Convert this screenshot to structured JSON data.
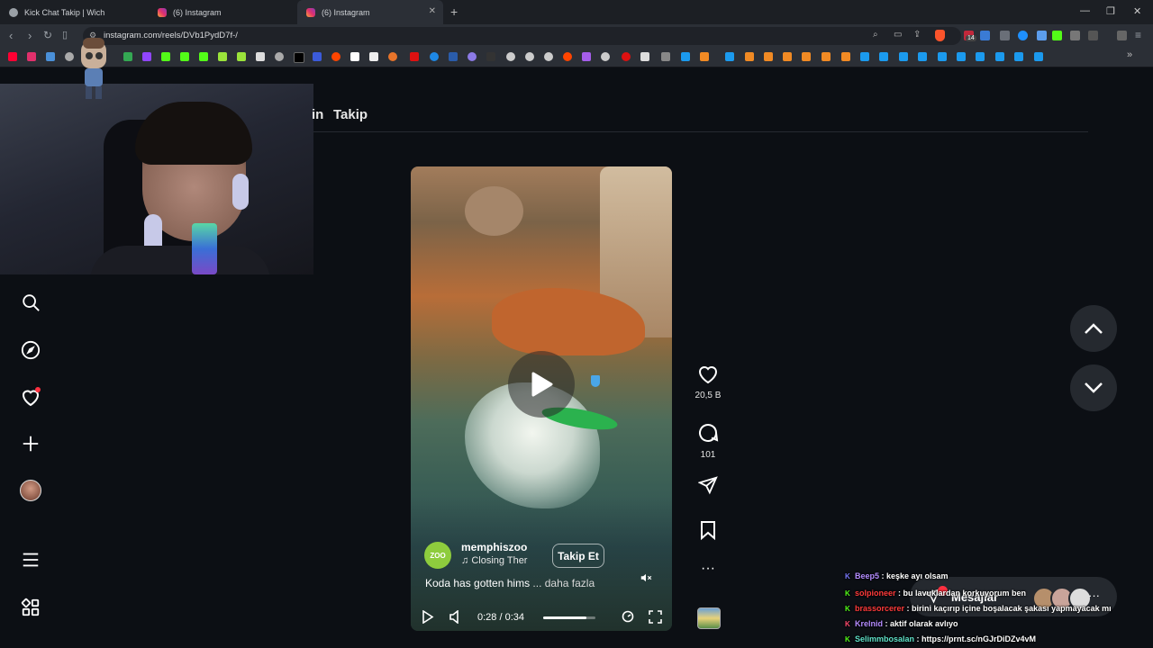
{
  "browser": {
    "tabs": [
      {
        "label": "Kick Chat Takip | Wich",
        "active": false,
        "color": "#9aa0a6"
      },
      {
        "label": "(6) Instagram",
        "active": false,
        "color": "#e1306c"
      },
      {
        "label": "(6) Instagram",
        "active": true,
        "color": "#e1306c"
      }
    ],
    "new_tab": "+",
    "url": "instagram.com/reels/DVb1PydD7f-/",
    "window_controls": {
      "minimize": "—",
      "restore": "❐",
      "close": "✕"
    },
    "extension_badge": "14"
  },
  "header": {
    "fragment": "in",
    "following": "Takip"
  },
  "sidebar": {
    "icons": [
      "search-icon",
      "explore-icon",
      "notifications-icon",
      "create-icon",
      "profile-icon",
      "more-menu-icon",
      "also-from-meta-icon"
    ]
  },
  "reel": {
    "username": "memphiszoo",
    "avatar_text": "ZOO",
    "music": "Closing Ther",
    "follow_label": "Takip Et",
    "caption": "Koda has gotten hims",
    "caption_more": " ... daha fazla",
    "time": "0:28 / 0:34",
    "progress": 0.82
  },
  "actions": {
    "likes": "20,5 B",
    "comments": "101"
  },
  "messages": {
    "label": "Mesajlar",
    "more": "···"
  },
  "chat": [
    {
      "badge": "K",
      "badge_color": "#7a7aff",
      "user": "Beep5",
      "user_color": "#b48cff",
      "text": " : keşke ayı olsam"
    },
    {
      "badge": "K",
      "badge_color": "#53fc18",
      "user": "solpioneer",
      "user_color": "#ff3b3b",
      "text": " : bu lavuklardan korkuyorum ben"
    },
    {
      "badge": "K",
      "badge_color": "#53fc18",
      "user": "brassorcerer",
      "user_color": "#ff3b3b",
      "text": " : birini kaçırıp içine boşalacak şakası yapmayacak mı"
    },
    {
      "badge": "K",
      "badge_color": "#ff4b6e",
      "user": "Krelnid",
      "user_color": "#b48cff",
      "text": " : aktif olarak avlıyo"
    },
    {
      "badge": "K",
      "badge_color": "#53fc18",
      "user": "Selimmbosalan",
      "user_color": "#5fe0c8",
      "text": " : https://prnt.sc/nGJrDiDZv4vM"
    }
  ]
}
